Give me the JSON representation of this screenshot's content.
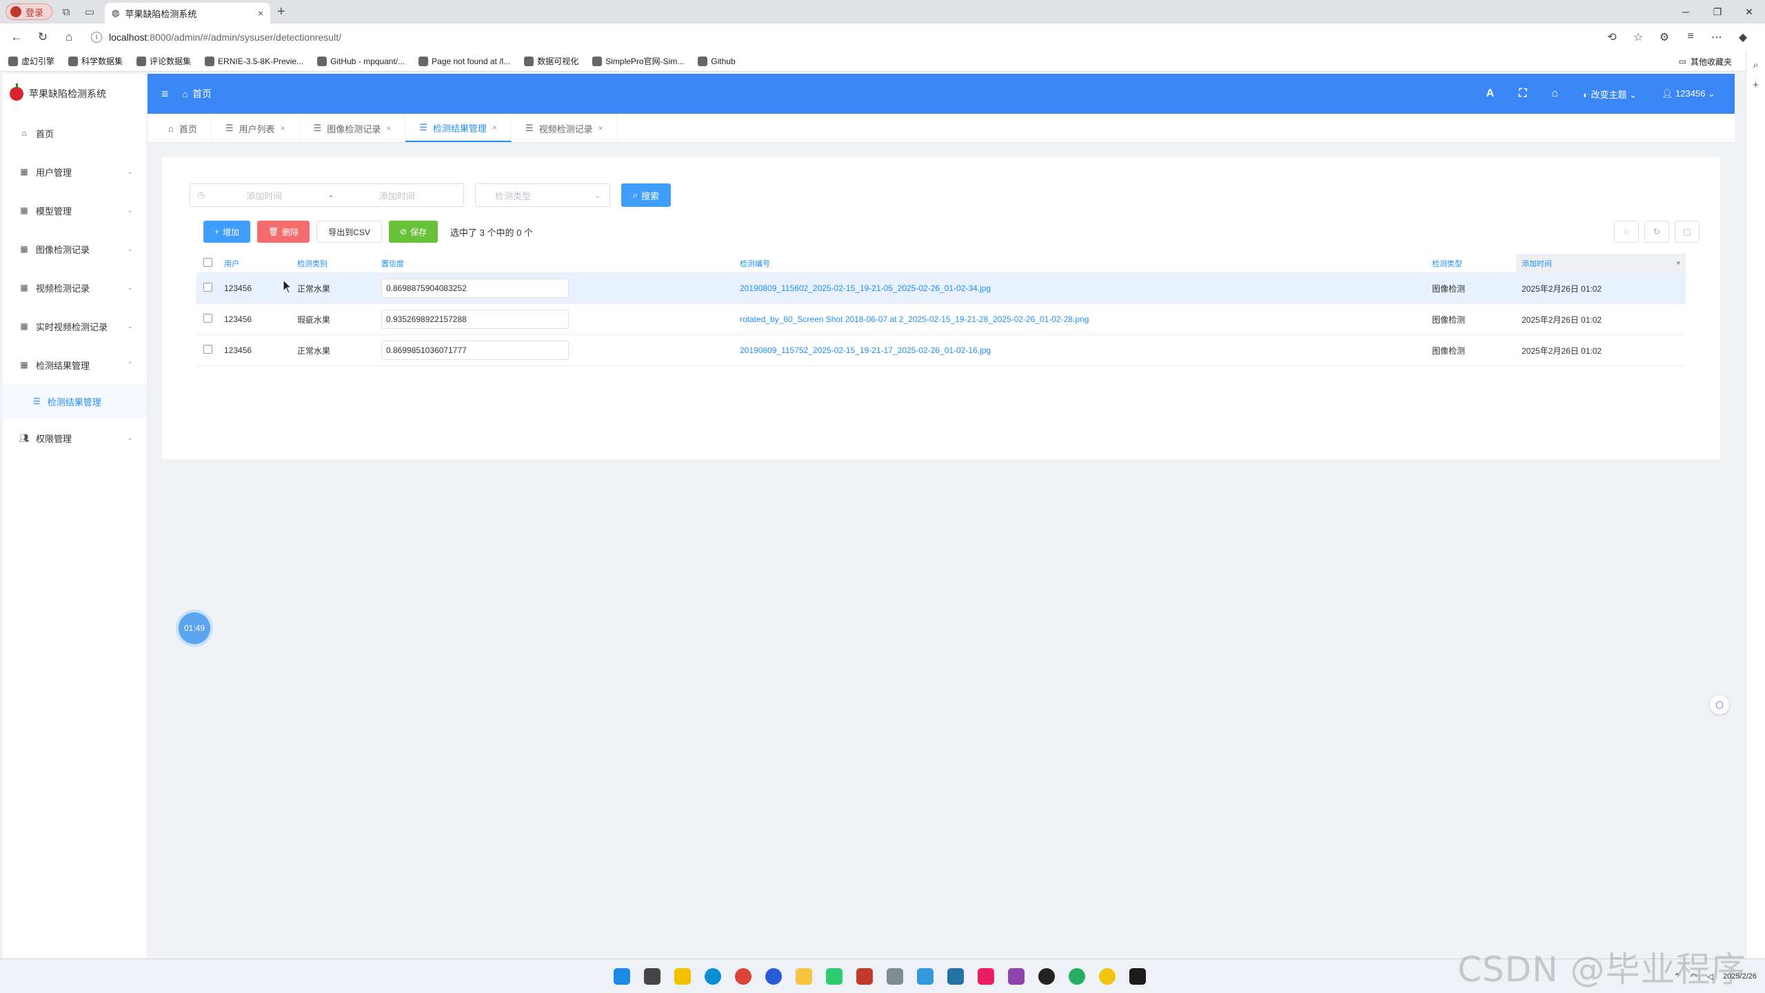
{
  "browser": {
    "profile_label": "登录",
    "tab_title": "苹果缺陷检测系统",
    "tab_close": "×",
    "new_tab": "+",
    "url_host": "localhost",
    "url_rest": ":8000/admin/#/admin/sysuser/detectionresult/",
    "bookmarks": [
      "虚幻引擎",
      "科学数据集",
      "评论数据集",
      "ERNIE-3.5-8K-Previe...",
      "GitHub - mpquant/...",
      "Page not found at /l...",
      "数据可视化",
      "SimplePro官网-Sim...",
      "Github"
    ],
    "other_bookmarks": "其他收藏夹"
  },
  "sidebar": {
    "app_name": "苹果缺陷检测系统",
    "items": [
      {
        "label": "首页",
        "icon": "home-icon"
      },
      {
        "label": "用户管理",
        "icon": "table-icon"
      },
      {
        "label": "模型管理",
        "icon": "table-icon"
      },
      {
        "label": "图像检测记录",
        "icon": "table-icon"
      },
      {
        "label": "视频检测记录",
        "icon": "table-icon"
      },
      {
        "label": "实时视频检测记录",
        "icon": "table-icon"
      },
      {
        "label": "检测结果管理",
        "icon": "table-icon"
      },
      {
        "label": "权限管理",
        "icon": "users-icon"
      }
    ],
    "subitem": "检测结果管理"
  },
  "topbar": {
    "home": "首页",
    "theme": "改变主题",
    "user": "123456"
  },
  "tabs": [
    {
      "label": "首页",
      "closable": false,
      "active": false
    },
    {
      "label": "用户列表",
      "closable": true,
      "active": false
    },
    {
      "label": "图像检测记录",
      "closable": true,
      "active": false
    },
    {
      "label": "检测结果管理",
      "closable": true,
      "active": true
    },
    {
      "label": "视频检测记录",
      "closable": true,
      "active": false
    }
  ],
  "filter": {
    "start_placeholder": "添加时间",
    "separator": "-",
    "end_placeholder": "添加时间",
    "type_placeholder": "检测类型",
    "search": "搜索"
  },
  "toolbar": {
    "add": "增加",
    "delete": "删除",
    "export": "导出到CSV",
    "save": "保存",
    "selection_info": "选中了 3 个中的 0 个"
  },
  "table": {
    "headers": {
      "user": "用户",
      "category": "检测类别",
      "confidence": "置信度",
      "number": "检测编号",
      "type": "检测类型",
      "time": "添加时间"
    },
    "rows": [
      {
        "user": "123456",
        "category": "正常水果",
        "confidence": "0.8698875904083252",
        "number": "20190809_115602_2025-02-15_19-21-05_2025-02-26_01-02-34.jpg",
        "type": "图像检测",
        "time": "2025年2月26日 01:02"
      },
      {
        "user": "123456",
        "category": "瑕疵水果",
        "confidence": "0.9352698922157288",
        "number": "rotated_by_60_Screen Shot 2018-06-07 at 2_2025-02-15_19-21-28_2025-02-26_01-02-28.png",
        "type": "图像检测",
        "time": "2025年2月26日 01:02"
      },
      {
        "user": "123456",
        "category": "正常水果",
        "confidence": "0.8699851036071777",
        "number": "20190809_115752_2025-02-15_19-21-17_2025-02-26_01-02-16.jpg",
        "type": "图像检测",
        "time": "2025年2月26日 01:02"
      }
    ]
  },
  "timer": "01:49",
  "taskbar": {
    "date": "2025/2/26"
  },
  "watermark": "CSDN @毕业程序员",
  "colors": {
    "primary": "#3a86f5",
    "link": "#1e90ff",
    "danger": "#f56c6c",
    "success": "#67c23a"
  }
}
